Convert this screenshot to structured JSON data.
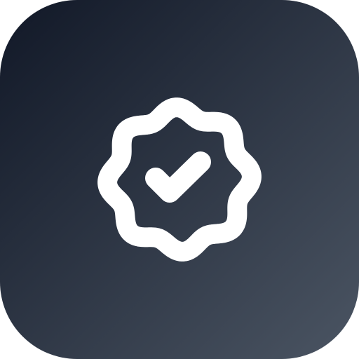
{
  "icon": {
    "name": "verified-badge-icon",
    "background_gradient": [
      "#111827",
      "#4b5563"
    ],
    "glyph_color": "#ffffff"
  }
}
